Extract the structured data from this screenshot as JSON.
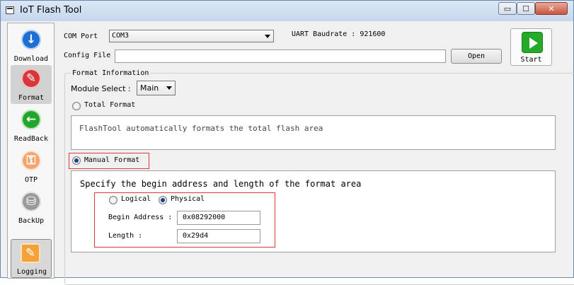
{
  "window": {
    "title": "IoT Flash Tool",
    "min_glyph": "▭",
    "max_glyph": "☐",
    "close_glyph": "✕"
  },
  "sidebar": {
    "items": [
      {
        "label": "Download",
        "icon": "download-icon",
        "glyph": "↓",
        "color": "#1e6fd4"
      },
      {
        "label": "Format",
        "icon": "format-icon",
        "glyph": "✎",
        "color": "#d6373b",
        "active": true
      },
      {
        "label": "ReadBack",
        "icon": "readback-icon",
        "glyph": "←",
        "color": "#22a52b"
      },
      {
        "label": "OTP",
        "icon": "otp-icon",
        "glyph": "⚿",
        "color": "#f3a56d"
      },
      {
        "label": "BackUp",
        "icon": "backup-icon",
        "glyph": "⛁",
        "color": "#9a9a9a"
      },
      {
        "label": "Logging",
        "icon": "logging-icon",
        "glyph": "✎",
        "color": "#f5a23a"
      }
    ]
  },
  "top": {
    "com_port_label": "COM Port",
    "com_port_value": "COM3",
    "baud_label": "UART Baudrate : 921600",
    "config_file_label": "Config File",
    "config_file_value": "",
    "open_button": "Open",
    "start_button": "Start"
  },
  "format_info": {
    "group_title": "Format Information",
    "module_select_label": "Module Select :",
    "module_select_value": "Main",
    "total_format_label": "Total Format",
    "total_format_desc": "FlashTool automatically formats the total flash area",
    "manual_format_label": "Manual Format",
    "manual_format_desc": "Specify the begin address and length of the format area",
    "logical_label": "Logical",
    "physical_label": "Physical",
    "begin_address_label": "Begin Address :",
    "begin_address_value": "0x08292000",
    "length_label": "Length :",
    "length_value": "0x29d4"
  }
}
